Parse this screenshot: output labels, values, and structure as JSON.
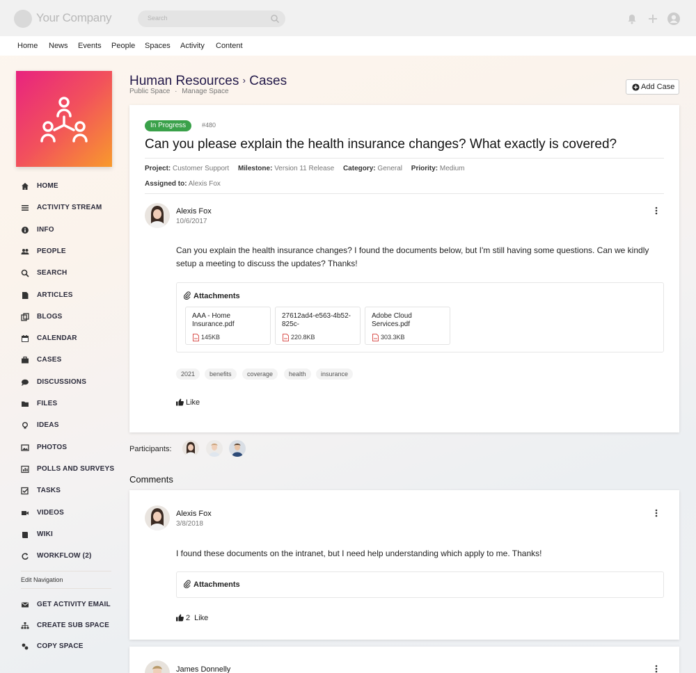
{
  "topbar": {
    "company": "Your Company",
    "search_placeholder": "Search"
  },
  "main_nav": [
    "Home",
    "News",
    "Events",
    "People",
    "Spaces",
    "Activity",
    "Content"
  ],
  "header": {
    "space": "Human Resources",
    "separator": "›",
    "section": "Cases",
    "public_space": "Public Space",
    "dot": "·",
    "manage_space": "Manage Space",
    "add_case": "Add Case"
  },
  "sidebar": {
    "items": [
      {
        "label": "HOME",
        "icon": "home-icon"
      },
      {
        "label": "ACTIVITY STREAM",
        "icon": "list-icon"
      },
      {
        "label": "INFO",
        "icon": "info-icon"
      },
      {
        "label": "PEOPLE",
        "icon": "people-icon"
      },
      {
        "label": "SEARCH",
        "icon": "search-icon"
      },
      {
        "label": "ARTICLES",
        "icon": "article-icon"
      },
      {
        "label": "BLOGS",
        "icon": "blog-icon"
      },
      {
        "label": "CALENDAR",
        "icon": "calendar-icon"
      },
      {
        "label": "CASES",
        "icon": "case-icon"
      },
      {
        "label": "DISCUSSIONS",
        "icon": "chat-icon"
      },
      {
        "label": "FILES",
        "icon": "folder-icon"
      },
      {
        "label": "IDEAS",
        "icon": "lightbulb-icon"
      },
      {
        "label": "PHOTOS",
        "icon": "photo-icon"
      },
      {
        "label": "POLLS AND SURVEYS",
        "icon": "chart-icon"
      },
      {
        "label": "TASKS",
        "icon": "checkbox-icon"
      },
      {
        "label": "VIDEOS",
        "icon": "video-icon"
      },
      {
        "label": "WIKI",
        "icon": "book-icon"
      },
      {
        "label": "WORKFLOW (2)",
        "icon": "refresh-icon"
      }
    ],
    "edit_nav": "Edit Navigation",
    "actions": [
      {
        "label": "GET ACTIVITY EMAIL",
        "icon": "email-icon"
      },
      {
        "label": "CREATE SUB SPACE",
        "icon": "sitemap-icon"
      },
      {
        "label": "COPY SPACE",
        "icon": "copy-icon"
      }
    ]
  },
  "case": {
    "status": "In Progress",
    "number": "#480",
    "title": "Can you please explain the health insurance changes? What exactly is covered?",
    "project_label": "Project:",
    "project": "Customer Support",
    "milestone_label": "Milestone:",
    "milestone": "Version 11 Release",
    "category_label": "Category:",
    "category": "General",
    "priority_label": "Priority:",
    "priority": "Medium",
    "assigned_label": "Assigned to:",
    "assigned": "Alexis Fox",
    "author": "Alexis Fox",
    "date": "10/6/2017",
    "body": "Can you explain the health insurance changes? I found the documents below, but I'm still having some questions. Can we kindly setup a meeting to discuss the updates? Thanks!",
    "attachments_title": "Attachments",
    "files": [
      {
        "name": "AAA - Home Insurance.pdf",
        "size": "145KB"
      },
      {
        "name": "27612ad4-e563-4b52-825c-",
        "size": "220.8KB"
      },
      {
        "name": "Adobe Cloud Services.pdf",
        "size": "303.3KB"
      }
    ],
    "tags": [
      "2021",
      "benefits",
      "coverage",
      "health",
      "insurance"
    ],
    "like": "Like"
  },
  "participants_label": "Participants:",
  "comments_title": "Comments",
  "comments": [
    {
      "author": "Alexis Fox",
      "date": "3/8/2018",
      "body": "I found these documents on the intranet, but I need help understanding which apply to me. Thanks!",
      "attachments_title": "Attachments",
      "like_count": "2",
      "like": "Like"
    },
    {
      "author": "James Donnelly"
    }
  ],
  "colors": {
    "status_green": "#3aa14a",
    "title_navy": "#241a4a",
    "logo_start": "#e8237f",
    "logo_end": "#f89a2c"
  }
}
